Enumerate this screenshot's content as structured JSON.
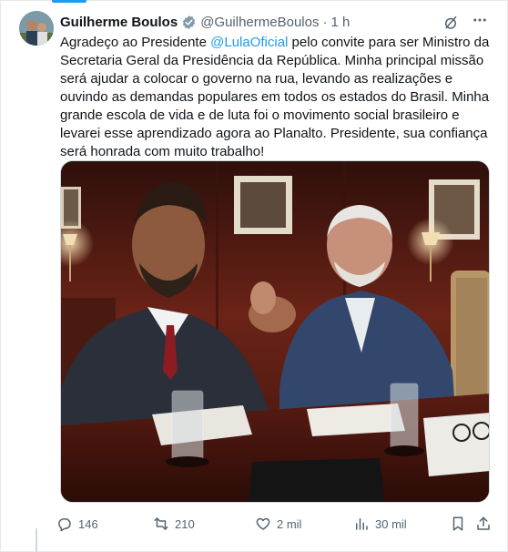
{
  "colors": {
    "accent": "#1d9bf0",
    "text": "#0f1419",
    "secondary": "#536471"
  },
  "tweet": {
    "author_name": "Guilherme Boulos",
    "handle": "@GuilhermeBoulos",
    "separator": "·",
    "time": "1 h",
    "text_before": "Agradeço ao Presidente ",
    "mention": "@LulaOficial",
    "text_after": " pelo convite para ser Ministro da Secretaria Geral da Presidência da República. Minha principal missão será ajudar a colocar o governo na rua, levando as realizações e ouvindo as demandas populares em todos os estados do Brasil. Minha grande escola de vida e de luta foi o movimento social brasileiro e levarei esse aprendizado agora ao Planalto. Presidente, sua confiança será honrada com muito trabalho!"
  },
  "icons": {
    "verified": "verified-badge-icon",
    "grok": "slashed-circle-icon",
    "more": "more-icon",
    "reply": "reply-icon",
    "retweet": "retweet-icon",
    "like": "heart-icon",
    "views": "views-chart-icon",
    "bookmark": "bookmark-icon",
    "share": "share-icon"
  },
  "actions": {
    "replies": "146",
    "retweets": "210",
    "likes": "2 mil",
    "views": "30 mil"
  }
}
